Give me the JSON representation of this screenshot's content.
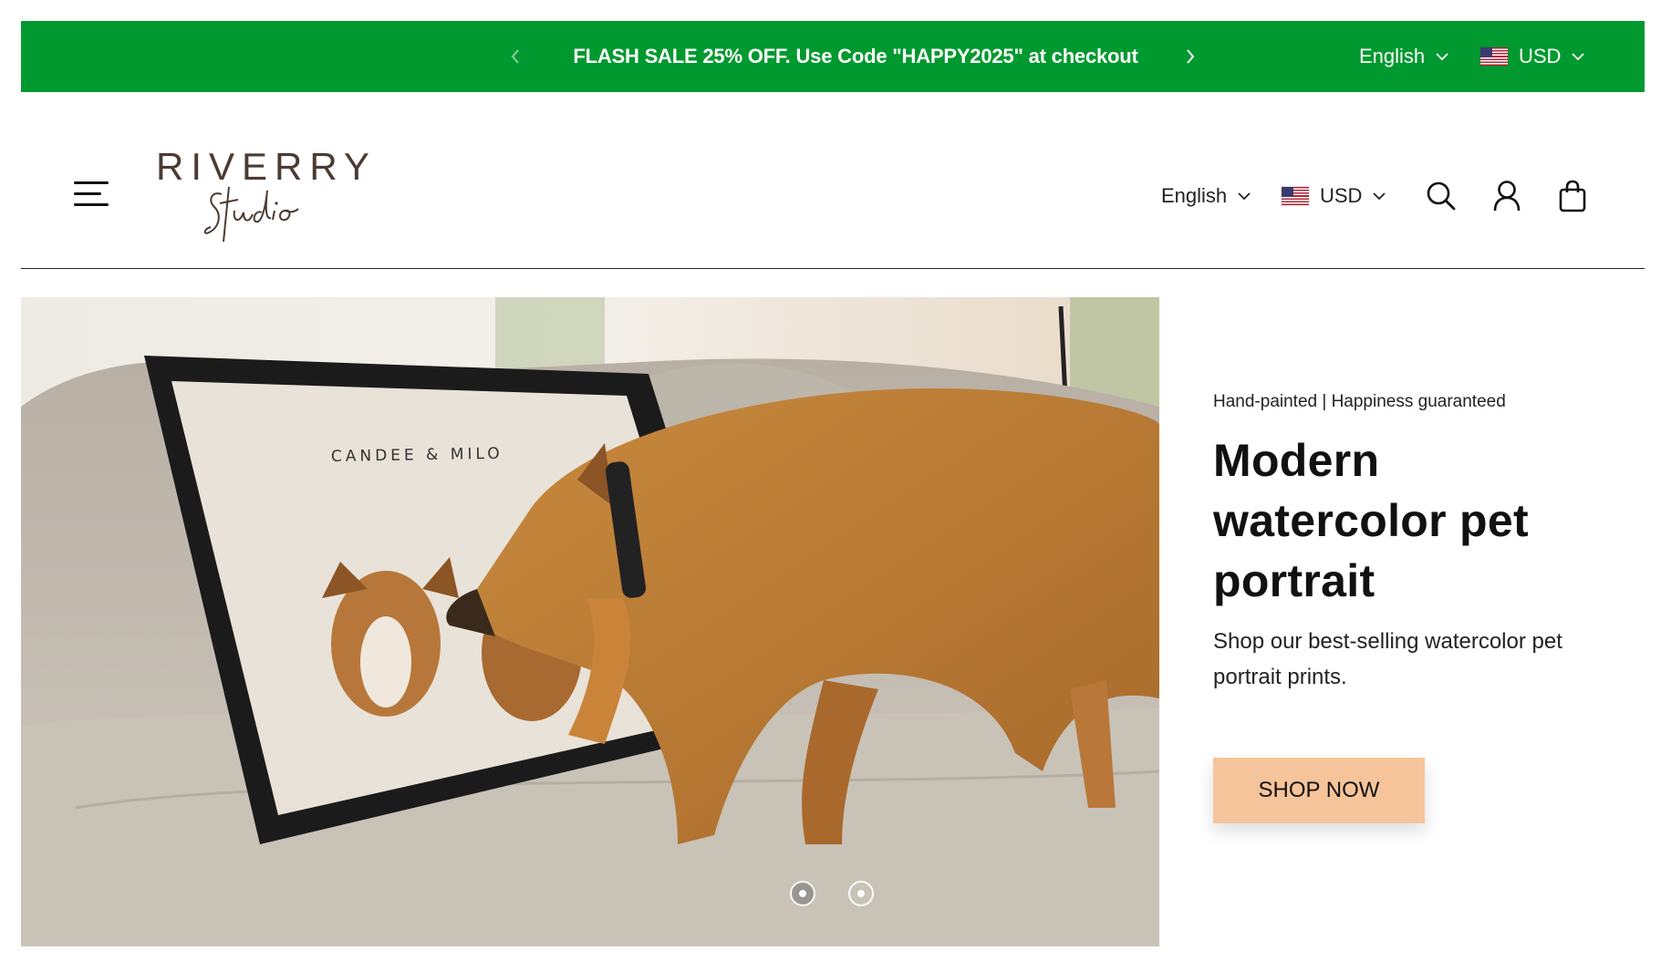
{
  "announcement": {
    "message": "FLASH SALE 25% OFF. Use Code \"HAPPY2025\" at checkout",
    "language": "English",
    "currency": "USD",
    "bg_color": "#00992f"
  },
  "header": {
    "logo_word": "RIVERRY",
    "logo_script": "Studio",
    "language": "English",
    "currency": "USD",
    "icons": [
      "menu-icon",
      "search-icon",
      "account-icon",
      "cart-icon"
    ]
  },
  "hero": {
    "image_text": "CANDEE & MILO",
    "eyebrow": "Hand-painted | Happiness guaranteed",
    "title": "Modern watercolor pet portrait",
    "subtitle": "Shop our best-selling watercolor pet portrait prints.",
    "cta": "SHOP NOW",
    "cta_color": "#f6c49a",
    "slides_total": 2,
    "slide_active": 1
  }
}
